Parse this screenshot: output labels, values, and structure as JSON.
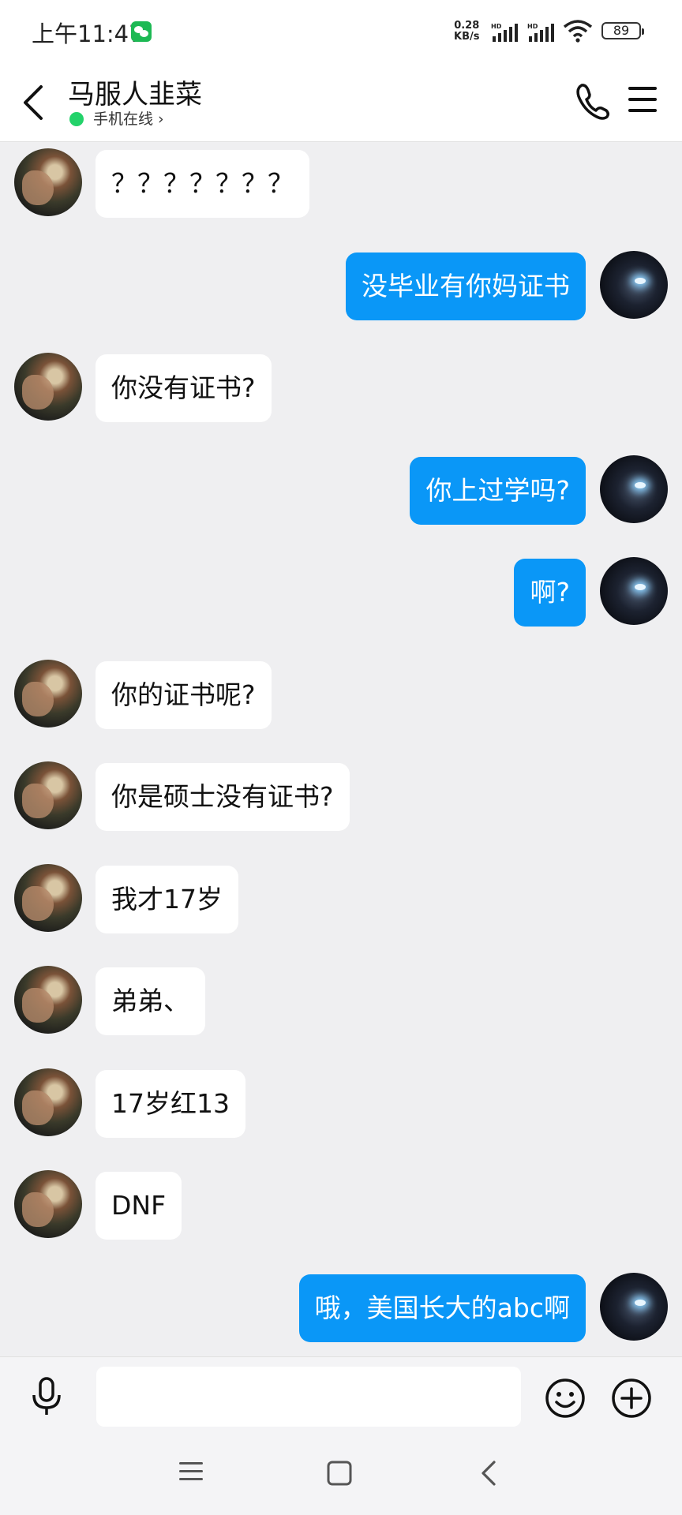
{
  "status_bar": {
    "time": "上午11:47",
    "net_speed_value": "0.28",
    "net_speed_unit": "KB/s",
    "signal_label_1": "HD",
    "signal_label_2": "HD",
    "battery": "89"
  },
  "header": {
    "contact_name": "马服人韭菜",
    "online_status": "手机在线 ›"
  },
  "messages": [
    {
      "side": "left",
      "text": "？？？？？？？"
    },
    {
      "side": "right",
      "text": "没毕业有你妈证书"
    },
    {
      "side": "left",
      "text": "你没有证书?"
    },
    {
      "side": "right",
      "text": "你上过学吗?"
    },
    {
      "side": "right",
      "text": "啊?"
    },
    {
      "side": "left",
      "text": "你的证书呢?"
    },
    {
      "side": "left",
      "text": "你是硕士没有证书?"
    },
    {
      "side": "left",
      "text": "我才17岁"
    },
    {
      "side": "left",
      "text": "弟弟、"
    },
    {
      "side": "left",
      "text": "17岁红13"
    },
    {
      "side": "left",
      "text": "DNF"
    },
    {
      "side": "right",
      "text": "哦，美国长大的abc啊"
    }
  ],
  "input": {
    "value": "",
    "placeholder": ""
  },
  "colors": {
    "outgoing_bubble": "#0a97f7",
    "incoming_bubble": "#ffffff",
    "chat_background": "#efeff1",
    "online_dot": "#23d26a"
  },
  "icons": {
    "status": [
      "wechat-icon",
      "signal-icon",
      "wifi-icon",
      "battery-icon"
    ],
    "header": [
      "back-icon",
      "phone-icon",
      "menu-icon"
    ],
    "input_bar": [
      "microphone-icon",
      "emoji-icon",
      "plus-icon"
    ],
    "nav": [
      "nav-menu-icon",
      "nav-home-icon",
      "nav-back-icon"
    ]
  }
}
